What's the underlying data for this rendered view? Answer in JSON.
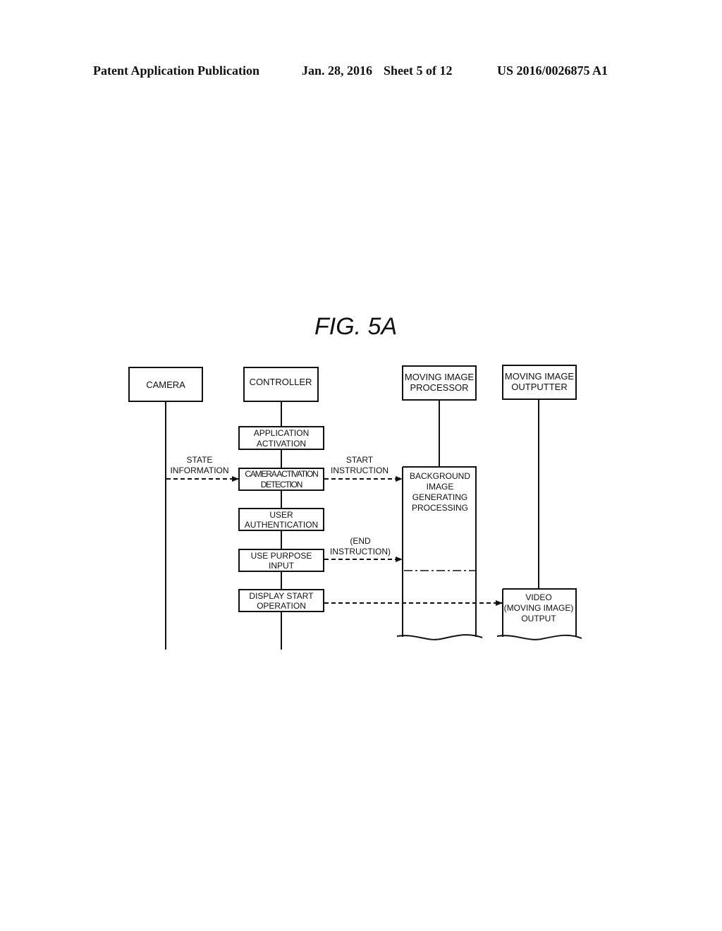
{
  "header": {
    "publication": "Patent Application Publication",
    "date": "Jan. 28, 2016",
    "sheet": "Sheet 5 of 12",
    "patent_number": "US 2016/0026875 A1"
  },
  "figure": {
    "title": "FIG. 5A",
    "lifelines": [
      {
        "id": "camera",
        "lines": [
          "CAMERA"
        ]
      },
      {
        "id": "controller",
        "lines": [
          "CONTROLLER"
        ]
      },
      {
        "id": "processor",
        "lines": [
          "MOVING IMAGE",
          "PROCESSOR"
        ]
      },
      {
        "id": "outputter",
        "lines": [
          "MOVING IMAGE",
          "OUTPUTTER"
        ]
      }
    ],
    "controller_steps": [
      {
        "id": "app-activation",
        "lines": [
          "APPLICATION",
          "ACTIVATION"
        ]
      },
      {
        "id": "camera-activation-detection",
        "lines": [
          "CAMERA ACTIVATION",
          "DETECTION"
        ]
      },
      {
        "id": "user-authentication",
        "lines": [
          "USER",
          "AUTHENTICATION"
        ]
      },
      {
        "id": "use-purpose-input",
        "lines": [
          "USE PURPOSE",
          "INPUT"
        ]
      },
      {
        "id": "display-start-operation",
        "lines": [
          "DISPLAY START",
          "OPERATION"
        ]
      }
    ],
    "messages": [
      {
        "id": "state-information",
        "lines": [
          "STATE",
          "INFORMATION"
        ],
        "from": "camera",
        "to": "controller"
      },
      {
        "id": "start-instruction",
        "lines": [
          "START",
          "INSTRUCTION"
        ],
        "from": "controller",
        "to": "processor"
      },
      {
        "id": "end-instruction",
        "lines": [
          "(END",
          "INSTRUCTION)"
        ],
        "from": "controller",
        "to": "processor"
      },
      {
        "id": "display-start",
        "lines": [],
        "from": "controller",
        "to": "outputter"
      }
    ],
    "activities": [
      {
        "id": "background-image-generating-processing",
        "lines": [
          "BACKGROUND",
          "IMAGE",
          "GENERATING",
          "PROCESSING"
        ]
      },
      {
        "id": "video-output",
        "lines": [
          "VIDEO",
          "(MOVING IMAGE)",
          "OUTPUT"
        ]
      }
    ]
  }
}
